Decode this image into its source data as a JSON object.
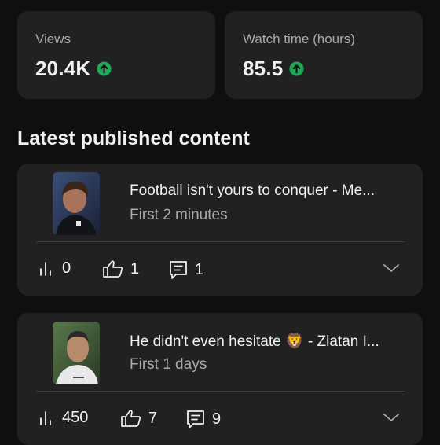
{
  "stats": [
    {
      "label": "Views",
      "value": "20.4K",
      "trend": "up"
    },
    {
      "label": "Watch time (hours)",
      "value": "85.5",
      "trend": "up"
    }
  ],
  "section_title": "Latest published content",
  "videos": [
    {
      "title": "Football isn't yours to conquer - Me...",
      "subtitle": "First 2 minutes",
      "views": "0",
      "likes": "1",
      "comments": "1"
    },
    {
      "title": "He didn't even hesitate 🦁 - Zlatan I...",
      "subtitle": "First 1 days",
      "views": "450",
      "likes": "7",
      "comments": "9"
    }
  ],
  "colors": {
    "background": "#0f0f0f",
    "card": "#212121",
    "trend_up": "#1fa75a",
    "secondary_text": "#aaaaaa"
  }
}
